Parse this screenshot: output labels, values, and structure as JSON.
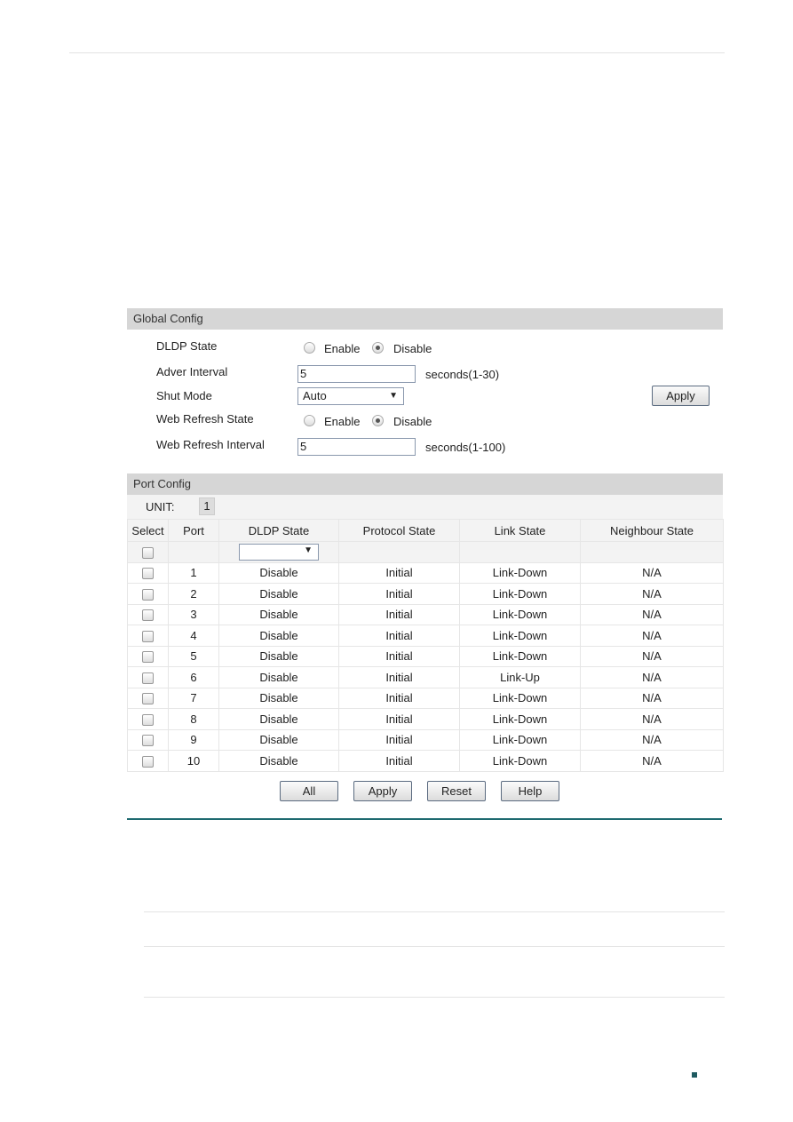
{
  "global_config": {
    "title": "Global Config",
    "dldp_state": {
      "label": "DLDP State",
      "options": [
        "Enable",
        "Disable"
      ],
      "selected": "Disable"
    },
    "adver_interval": {
      "label": "Adver Interval",
      "value": "5",
      "hint": "seconds(1-30)"
    },
    "shut_mode": {
      "label": "Shut Mode",
      "value": "Auto"
    },
    "web_refresh_state": {
      "label": "Web Refresh State",
      "options": [
        "Enable",
        "Disable"
      ],
      "selected": "Disable"
    },
    "web_refresh_interval": {
      "label": "Web Refresh Interval",
      "value": "5",
      "hint": "seconds(1-100)"
    },
    "apply_label": "Apply"
  },
  "port_config": {
    "title": "Port Config",
    "unit_label": "UNIT:",
    "unit_value": "1",
    "columns": [
      "Select",
      "Port",
      "DLDP State",
      "Protocol State",
      "Link State",
      "Neighbour State"
    ],
    "rows": [
      {
        "port": "1",
        "dldp": "Disable",
        "protocol": "Initial",
        "link": "Link-Down",
        "neighbour": "N/A"
      },
      {
        "port": "2",
        "dldp": "Disable",
        "protocol": "Initial",
        "link": "Link-Down",
        "neighbour": "N/A"
      },
      {
        "port": "3",
        "dldp": "Disable",
        "protocol": "Initial",
        "link": "Link-Down",
        "neighbour": "N/A"
      },
      {
        "port": "4",
        "dldp": "Disable",
        "protocol": "Initial",
        "link": "Link-Down",
        "neighbour": "N/A"
      },
      {
        "port": "5",
        "dldp": "Disable",
        "protocol": "Initial",
        "link": "Link-Down",
        "neighbour": "N/A"
      },
      {
        "port": "6",
        "dldp": "Disable",
        "protocol": "Initial",
        "link": "Link-Up",
        "neighbour": "N/A"
      },
      {
        "port": "7",
        "dldp": "Disable",
        "protocol": "Initial",
        "link": "Link-Down",
        "neighbour": "N/A"
      },
      {
        "port": "8",
        "dldp": "Disable",
        "protocol": "Initial",
        "link": "Link-Down",
        "neighbour": "N/A"
      },
      {
        "port": "9",
        "dldp": "Disable",
        "protocol": "Initial",
        "link": "Link-Down",
        "neighbour": "N/A"
      },
      {
        "port": "10",
        "dldp": "Disable",
        "protocol": "Initial",
        "link": "Link-Down",
        "neighbour": "N/A"
      }
    ],
    "buttons": {
      "all": "All",
      "apply": "Apply",
      "reset": "Reset",
      "help": "Help"
    }
  },
  "colors": {
    "accent": "#1e6a70",
    "section_header": "#d6d6d6"
  }
}
